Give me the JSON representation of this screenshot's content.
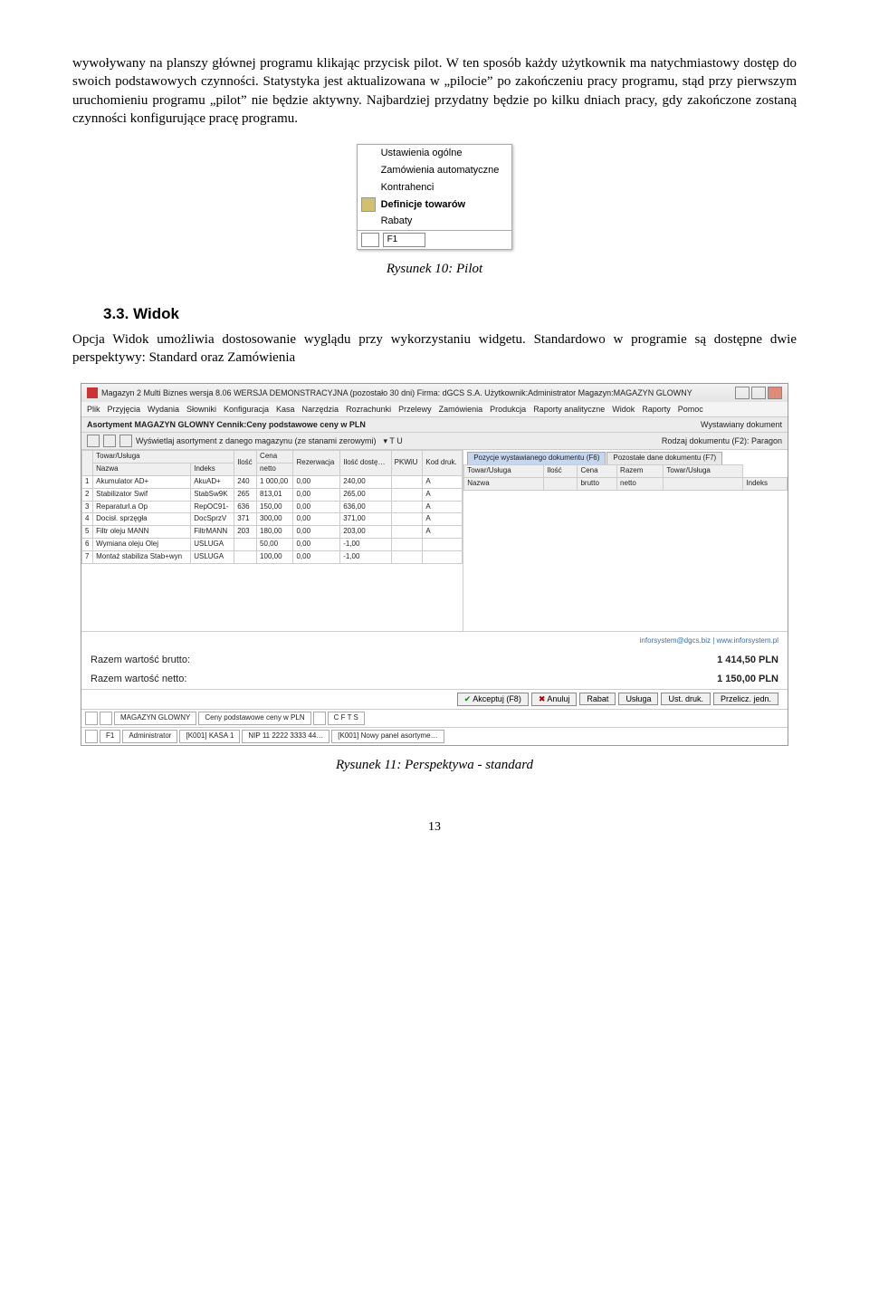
{
  "para1": "wywoływany na planszy głównej programu klikając przycisk pilot. W ten sposób każdy użytkownik ma natychmiastowy dostęp do swoich podstawowych czynności. Statystyka jest aktualizowana w „pilocie” po zakończeniu pracy programu, stąd przy pierwszym uruchomieniu programu „pilot” nie będzie aktywny. Najbardziej przydatny będzie po kilku dniach pracy, gdy zakończone zostaną czynności konfigurujące pracę programu.",
  "caption1": "Rysunek 10: Pilot",
  "h2": "3.3. Widok",
  "para2": "Opcja Widok umożliwia dostosowanie wyglądu przy wykorzystaniu widgetu. Standardowo w programie są dostępne dwie perspektywy: Standard oraz Zamówienia",
  "caption2": "Rysunek 11: Perspektywa - standard",
  "pageNum": "13",
  "pilotMenu": {
    "items": [
      "Ustawienia ogólne",
      "Zamówienia automatyczne",
      "Kontrahenci",
      "Definicje towarów",
      "Rabaty"
    ],
    "boldIndex": 3,
    "f1": "F1"
  },
  "persp": {
    "title": "Magazyn 2 Multi Biznes wersja 8.06 WERSJA DEMONSTRACYJNA (pozostało 30 dni)  Firma: dGCS S.A.   Użytkownik:Administrator   Magazyn:MAGAZYN GLOWNY",
    "menu": [
      "Plik",
      "Przyjęcia",
      "Wydania",
      "Słowniki",
      "Konfiguracja",
      "Kasa",
      "Narzędzia",
      "Rozrachunki",
      "Przelewy",
      "Zamówienia",
      "Produkcja",
      "Raporty analityczne",
      "Widok",
      "Raporty",
      "Pomoc"
    ],
    "toolbarLeft": "Asortyment MAGAZYN GLOWNY Cennik:Ceny podstawowe ceny w PLN",
    "toolbarRight": "Wystawiany dokument",
    "filterLabel": "Wyświetlaj asortyment z danego magazynu (ze stanami zerowymi)",
    "leftHeaders1": [
      "Towar/Usługa",
      "Ilość",
      "Cena",
      "Rezerwacja",
      "Ilość dostę…",
      "PKWiU",
      "Kod druk."
    ],
    "leftHeaders2": [
      "Nazwa",
      "Indeks",
      "",
      "netto",
      "",
      "",
      "",
      ""
    ],
    "leftRows": [
      [
        "1",
        "Akumulator AD+",
        "AkuAD+",
        "240",
        "1 000,00",
        "0,00",
        "240,00",
        "",
        "A"
      ],
      [
        "2",
        "Stabilizator Swif",
        "StabSw9K",
        "265",
        "813,01",
        "0,00",
        "265,00",
        "",
        "A"
      ],
      [
        "3",
        "Reparaturl.a Op",
        "RepOC91-",
        "636",
        "150,00",
        "0,00",
        "636,00",
        "",
        "A"
      ],
      [
        "4",
        "Docisł. sprzęgła",
        "DocSprzV",
        "371",
        "300,00",
        "0,00",
        "371,00",
        "",
        "A"
      ],
      [
        "5",
        "Filtr oleju MANN",
        "FiltrMANN",
        "203",
        "180,00",
        "0,00",
        "203,00",
        "",
        "A"
      ],
      [
        "6",
        "Wymiana oleju  Olej",
        "USLUGA",
        "",
        "50,00",
        "0,00",
        "-1,00",
        "",
        ""
      ],
      [
        "7",
        "Montaż stabiliza Stab+wyn",
        "USLUGA",
        "",
        "100,00",
        "0,00",
        "-1,00",
        "",
        ""
      ]
    ],
    "rightHeader": "Rodzaj dokumentu (F2): Paragon",
    "tabs": [
      "Pozycje wystawianego dokumentu (F6)",
      "Pozostałe dane dokumentu (F7)"
    ],
    "innerHeaders1": [
      "Towar/Usługa",
      "Ilość",
      "Cena",
      "Razem",
      "Towar/Usługa"
    ],
    "innerHeaders2": [
      "Nazwa",
      "",
      "brutto",
      "netto",
      "",
      "Indeks"
    ],
    "footerLink": "inforsystem@dgcs.biz  |  www.inforsystem.pl",
    "totals": [
      [
        "Razem wartość brutto:",
        "1 414,50 PLN"
      ],
      [
        "Razem wartość netto:",
        "1 150,00 PLN"
      ]
    ],
    "buttons": [
      "Akceptuj (F8)",
      "Anuluj",
      "Rabat",
      "Usługa",
      "Ust. druk.",
      "Przelicz. jedn."
    ],
    "statusUpper": [
      "",
      "",
      "MAGAZYN GLOWNY",
      "Ceny podstawowe ceny w PLN",
      "",
      "C F T S"
    ],
    "statusLower": [
      "",
      "F1",
      "Administrator",
      "[K001] KASA 1",
      "NIP 11 2222 3333 44…",
      "[K001] Nowy panel asortyme…"
    ]
  }
}
